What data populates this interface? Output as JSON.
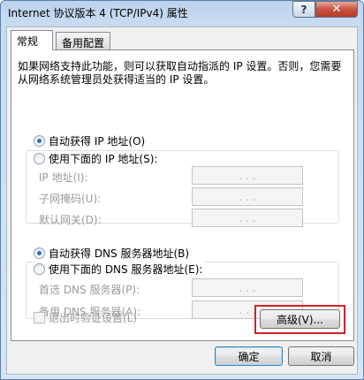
{
  "window": {
    "title": "Internet 协议版本 4 (TCP/IPv4) 属性",
    "help_glyph": "?",
    "close_glyph": "✕"
  },
  "tabs": [
    {
      "label": "常规",
      "active": true
    },
    {
      "label": "备用配置",
      "active": false
    }
  ],
  "description": "如果网络支持此功能，则可以获取自动指派的 IP 设置。否则，您需要从网络系统管理员处获得适当的 IP 设置。",
  "ip_section": {
    "auto_label": "自动获得 IP 地址(O)",
    "manual_label": "使用下面的 IP 地址(S):",
    "selected": "auto",
    "fields": [
      {
        "label": "IP 地址(I):",
        "value": ". . ."
      },
      {
        "label": "子网掩码(U):",
        "value": ". . ."
      },
      {
        "label": "默认网关(D):",
        "value": ". . ."
      }
    ]
  },
  "dns_section": {
    "auto_label": "自动获得 DNS 服务器地址(B)",
    "manual_label": "使用下面的 DNS 服务器地址(E):",
    "selected": "auto",
    "fields": [
      {
        "label": "首选 DNS 服务器(P):",
        "value": ". . ."
      },
      {
        "label": "备用 DNS 服务器(A):",
        "value": ". . ."
      }
    ]
  },
  "validate_label": "退出时验证设置(L)",
  "validate_checked": false,
  "buttons": {
    "advanced": "高级(V)...",
    "ok": "确定",
    "cancel": "取消"
  },
  "colors": {
    "highlight": "#d1222a",
    "titlebar": "#c7dbf0",
    "close_button": "#c85340"
  }
}
